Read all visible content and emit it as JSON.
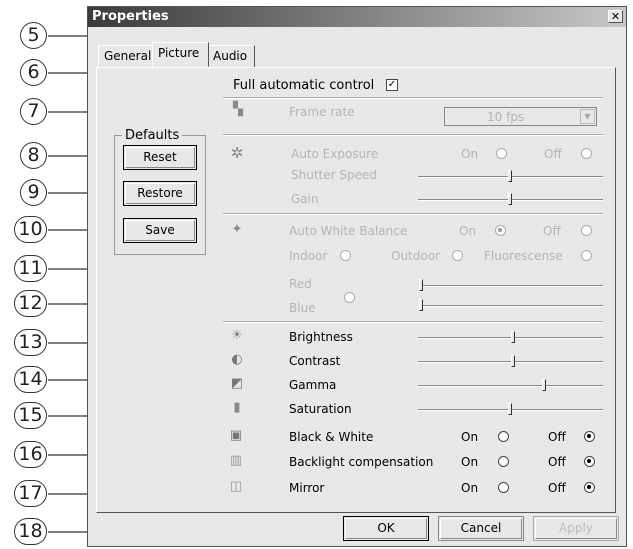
{
  "callouts": [
    "5",
    "6",
    "7",
    "8",
    "9",
    "10",
    "11",
    "12",
    "13",
    "14",
    "15",
    "16",
    "17",
    "18"
  ],
  "dialog": {
    "title": "Properties",
    "close_glyph": "✕",
    "tabs": [
      {
        "label": "General"
      },
      {
        "label": "Picture"
      },
      {
        "label": "Audio"
      }
    ],
    "full_auto_label": "Full automatic control",
    "full_auto_checked": "✓",
    "frame_rate_label": "Frame rate",
    "frame_rate_value": "10 fps",
    "defaults": {
      "title": "Defaults",
      "reset": "Reset",
      "restore": "Restore",
      "save": "Save"
    },
    "auto_exposure": "Auto Exposure",
    "shutter_speed": "Shutter Speed",
    "gain": "Gain",
    "awb": "Auto White Balance",
    "indoor": "Indoor",
    "outdoor": "Outdoor",
    "fluorescence": "Fluorescense",
    "red": "Red",
    "blue": "Blue",
    "brightness": "Brightness",
    "contrast": "Contrast",
    "gamma": "Gamma",
    "saturation": "Saturation",
    "black_white": "Black & White",
    "backlight": "Backlight compensation",
    "mirror": "Mirror",
    "on": "On",
    "off": "Off",
    "ok": "OK",
    "cancel": "Cancel",
    "apply": "Apply"
  }
}
